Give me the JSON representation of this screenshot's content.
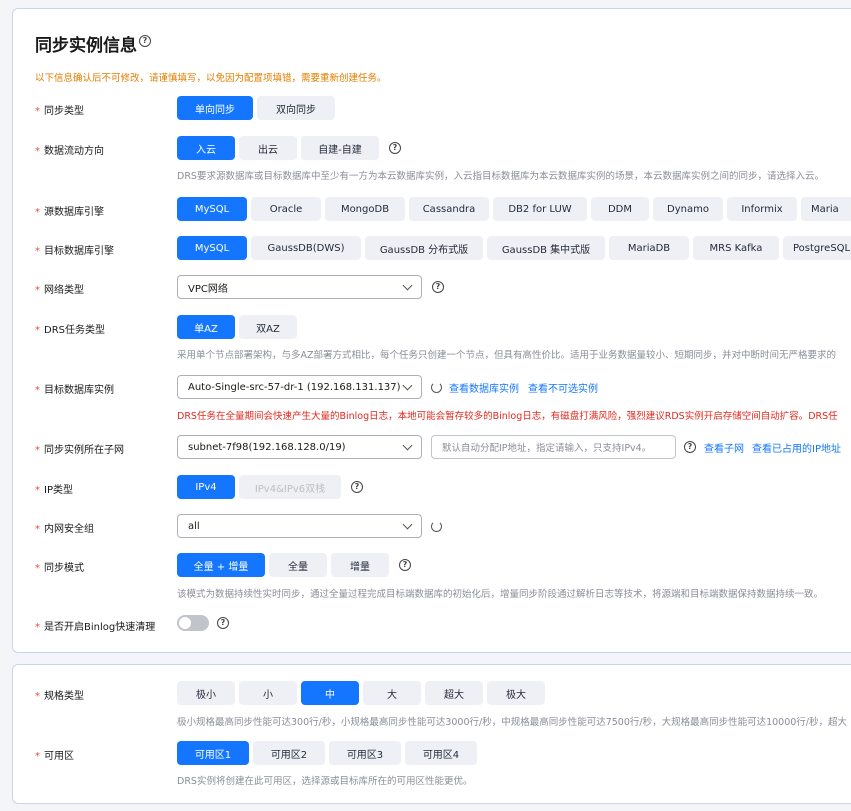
{
  "section1": {
    "title": "同步实例信息",
    "warning": "以下信息确认后不可修改，请谨慎填写，以免因为配置项填错，需要重新创建任务。",
    "sync_type": {
      "label": "同步类型",
      "options": [
        "单向同步",
        "双向同步"
      ],
      "selected": 0
    },
    "flow": {
      "label": "数据流动方向",
      "options": [
        "入云",
        "出云",
        "自建-自建"
      ],
      "selected": 0,
      "desc": "DRS要求源数据库或目标数据库中至少有一方为本云数据库实例，入云指目标数据库为本云数据库实例的场景，本云数据库实例之间的同步，请选择入云。"
    },
    "src_engine": {
      "label": "源数据库引擎",
      "options": [
        "MySQL",
        "Oracle",
        "MongoDB",
        "Cassandra",
        "DB2 for LUW",
        "DDM",
        "Dynamo",
        "Informix",
        "Maria"
      ],
      "selected": 0
    },
    "dst_engine": {
      "label": "目标数据库引擎",
      "options": [
        "MySQL",
        "GaussDB(DWS)",
        "GaussDB 分布式版",
        "GaussDB 集中式版",
        "MariaDB",
        "MRS Kafka",
        "PostgreSQL"
      ],
      "selected": 0
    },
    "network": {
      "label": "网络类型",
      "value": "VPC网络"
    },
    "drs_type": {
      "label": "DRS任务类型",
      "options": [
        "单AZ",
        "双AZ"
      ],
      "selected": 0,
      "desc": "采用单个节点部署架构，与多AZ部署方式相比，每个任务只创建一个节点，但具有高性价比。适用于业务数据量较小、短期同步，并对中断时间无严格要求的"
    },
    "target_instance": {
      "label": "目标数据库实例",
      "value": "Auto-Single-src-57-dr-1 (192.168.131.137)",
      "link1": "查看数据库实例",
      "link2": "查看不可选实例",
      "error": "DRS任务在全量期间会快速产生大量的Binlog日志，本地可能会暂存较多的Binlog日志，有磁盘打满风险，强烈建议RDS实例开启存储空间自动扩容。DRS任"
    },
    "subnet": {
      "label": "同步实例所在子网",
      "value": "subnet-7f98(192.168.128.0/19)",
      "ip_placeholder": "默认自动分配IP地址，指定请输入，只支持IPv4。",
      "link1": "查看子网",
      "link2": "查看已占用的IP地址"
    },
    "ip_type": {
      "label": "IP类型",
      "options": [
        "IPv4",
        "IPv4&IPv6双栈"
      ],
      "selected": 0
    },
    "sec_group": {
      "label": "内网安全组",
      "value": "all"
    },
    "sync_mode": {
      "label": "同步模式",
      "options": [
        "全量 + 增量",
        "全量",
        "增量"
      ],
      "selected": 0,
      "desc": "该模式为数据持续性实时同步，通过全量过程完成目标端数据库的初始化后，增量同步阶段通过解析日志等技术，将源端和目标端数据保持数据持续一致。"
    },
    "binlog": {
      "label": "是否开启Binlog快速清理",
      "enabled": false
    }
  },
  "section2": {
    "spec": {
      "label": "规格类型",
      "options": [
        "极小",
        "小",
        "中",
        "大",
        "超大",
        "极大"
      ],
      "selected": 2,
      "desc": "极小规格最高同步性能可达300行/秒，小规格最高同步性能可达3000行/秒，中规格最高同步性能可达7500行/秒，大规格最高同步性能可达10000行/秒，超大"
    },
    "az": {
      "label": "可用区",
      "options": [
        "可用区1",
        "可用区2",
        "可用区3",
        "可用区4"
      ],
      "selected": 0,
      "desc": "DRS实例将创建在此可用区，选择源或目标库所在的可用区性能更优。"
    }
  },
  "icons": {
    "help": "help-circle-icon",
    "refresh": "refresh-icon",
    "dropdown": "chevron-down-icon"
  },
  "colors": {
    "primary": "#1476ff",
    "warning": "#e37d00",
    "error": "#e0291f",
    "required": "#f04a3a"
  }
}
